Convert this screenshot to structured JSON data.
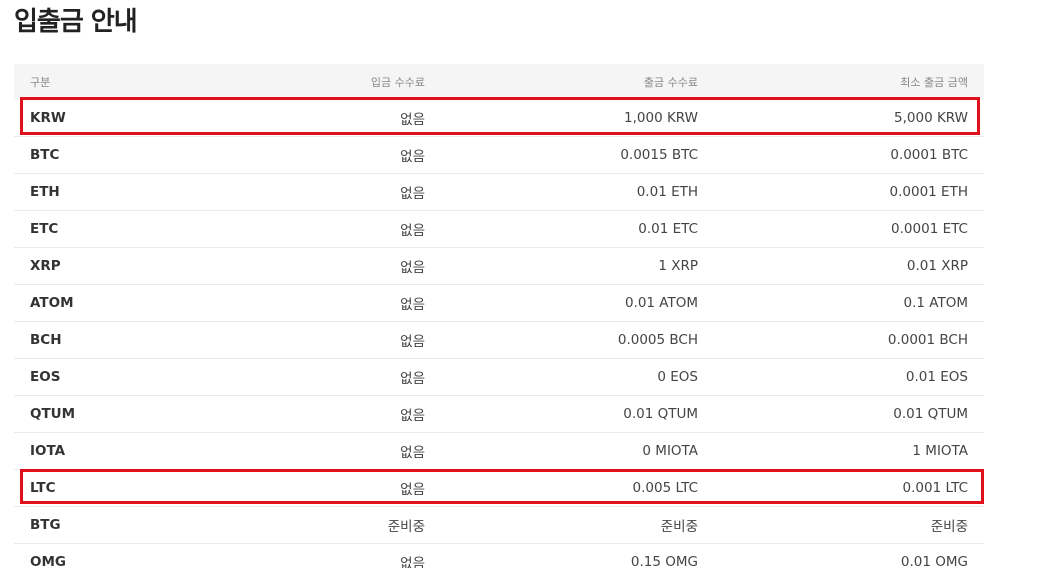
{
  "title": "입출금 안내",
  "table": {
    "headers": [
      "구분",
      "입금 수수료",
      "출금 수수료",
      "최소 출금 금액"
    ],
    "rows": [
      {
        "currency": "KRW",
        "deposit_fee": "없음",
        "withdraw_fee": "1,000 KRW",
        "min_withdraw": "5,000 KRW"
      },
      {
        "currency": "BTC",
        "deposit_fee": "없음",
        "withdraw_fee": "0.0015 BTC",
        "min_withdraw": "0.0001 BTC"
      },
      {
        "currency": "ETH",
        "deposit_fee": "없음",
        "withdraw_fee": "0.01 ETH",
        "min_withdraw": "0.0001 ETH"
      },
      {
        "currency": "ETC",
        "deposit_fee": "없음",
        "withdraw_fee": "0.01 ETC",
        "min_withdraw": "0.0001 ETC"
      },
      {
        "currency": "XRP",
        "deposit_fee": "없음",
        "withdraw_fee": "1 XRP",
        "min_withdraw": "0.01 XRP"
      },
      {
        "currency": "ATOM",
        "deposit_fee": "없음",
        "withdraw_fee": "0.01 ATOM",
        "min_withdraw": "0.1 ATOM"
      },
      {
        "currency": "BCH",
        "deposit_fee": "없음",
        "withdraw_fee": "0.0005 BCH",
        "min_withdraw": "0.0001 BCH"
      },
      {
        "currency": "EOS",
        "deposit_fee": "없음",
        "withdraw_fee": "0 EOS",
        "min_withdraw": "0.01 EOS"
      },
      {
        "currency": "QTUM",
        "deposit_fee": "없음",
        "withdraw_fee": "0.01 QTUM",
        "min_withdraw": "0.01 QTUM"
      },
      {
        "currency": "IOTA",
        "deposit_fee": "없음",
        "withdraw_fee": "0 MIOTA",
        "min_withdraw": "1 MIOTA"
      },
      {
        "currency": "LTC",
        "deposit_fee": "없음",
        "withdraw_fee": "0.005 LTC",
        "min_withdraw": "0.001 LTC"
      },
      {
        "currency": "BTG",
        "deposit_fee": "준비중",
        "withdraw_fee": "준비중",
        "min_withdraw": "준비중"
      },
      {
        "currency": "OMG",
        "deposit_fee": "없음",
        "withdraw_fee": "0.15 OMG",
        "min_withdraw": "0.01 OMG"
      }
    ]
  },
  "highlight_color": "#e0101a"
}
